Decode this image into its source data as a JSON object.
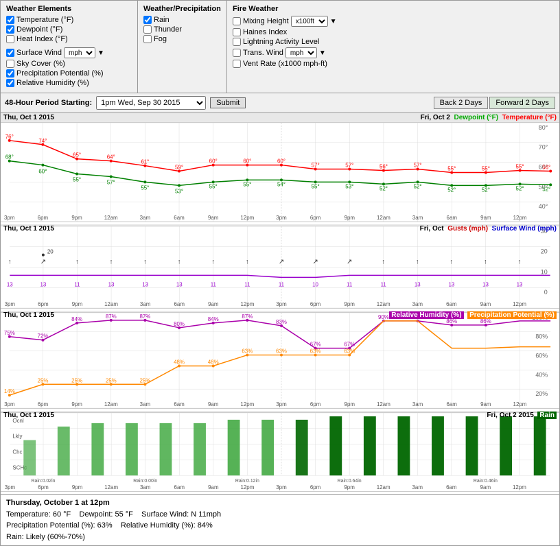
{
  "topPanel": {
    "weatherElements": {
      "title": "Weather Elements",
      "items": [
        {
          "label": "Temperature (°F)",
          "checked": true
        },
        {
          "label": "Dewpoint (°F)",
          "checked": true
        },
        {
          "label": "Heat Index (°F)",
          "checked": false
        },
        {
          "label": "Surface Wind",
          "checked": true,
          "hasSelect": true,
          "selectValue": "mph"
        },
        {
          "label": "Sky Cover (%)",
          "checked": false
        },
        {
          "label": "Precipitation Potential (%)",
          "checked": true
        },
        {
          "label": "Relative Humidity (%)",
          "checked": true
        }
      ]
    },
    "weatherPrecip": {
      "title": "Weather/Precipitation",
      "items": [
        {
          "label": "Rain",
          "checked": true
        },
        {
          "label": "Thunder",
          "checked": false
        },
        {
          "label": "Fog",
          "checked": false
        }
      ]
    },
    "fireWeather": {
      "title": "Fire Weather",
      "items": [
        {
          "label": "Mixing Height",
          "checked": false,
          "hasSelect": true,
          "selectValue": "x100ft"
        },
        {
          "label": "Haines Index",
          "checked": false
        },
        {
          "label": "Lightning Activity Level",
          "checked": false
        },
        {
          "label": "Trans. Wind",
          "checked": false,
          "hasSelect": true,
          "selectValue": "mph"
        },
        {
          "label": "Vent Rate (x1000 mph-ft)",
          "checked": false
        }
      ]
    }
  },
  "controlsBar": {
    "label": "48-Hour Period Starting:",
    "dateValue": "1pm Wed, Sep 30 2015",
    "submitLabel": "Submit",
    "backLabel": "Back 2 Days",
    "forwardLabel": "Forward 2 Days"
  },
  "charts": {
    "tempDewpoint": {
      "titleLeft": "Thu, Oct 1 2015",
      "titleRight": "Fri, Oct 2",
      "legendDewpoint": "Dewpoint (°F)",
      "legendTemp": "Temperature (°F)"
    },
    "wind": {
      "titleLeft": "Thu, Oct 1 2015",
      "titleRight": "Fri, Oct",
      "legendGusts": "Gusts (mph)",
      "legendWind": "Surface Wind (mph)"
    },
    "rhPrecip": {
      "titleLeft": "Thu, Oct 1 2015",
      "titleRight": "",
      "legendRH": "Relative Humidity (%)",
      "legendPrecip": "Precipitation Potential (%)"
    },
    "rain": {
      "titleLeft": "Thu, Oct 1 2015",
      "titleRight": "Fri, Oct 2 2015",
      "legendRain": "Rain"
    }
  },
  "infoBar": {
    "title": "Thursday, October 1 at 12pm",
    "line1left": "Temperature: 60 °F",
    "line1mid": "Dewpoint: 55 °F",
    "line1right": "Surface Wind: N 11mph",
    "line2left": "Precipitation Potential (%): 63%",
    "line2mid": "Relative Humidity (%): 84%",
    "line3": "Rain: Likely (60%-70%)"
  },
  "timeLabels": [
    "3pm",
    "6pm",
    "9pm",
    "12am",
    "3am",
    "6am",
    "9am",
    "12pm",
    "3pm",
    "6pm",
    "9pm",
    "12am",
    "3am",
    "6am",
    "9am",
    "12pm"
  ]
}
